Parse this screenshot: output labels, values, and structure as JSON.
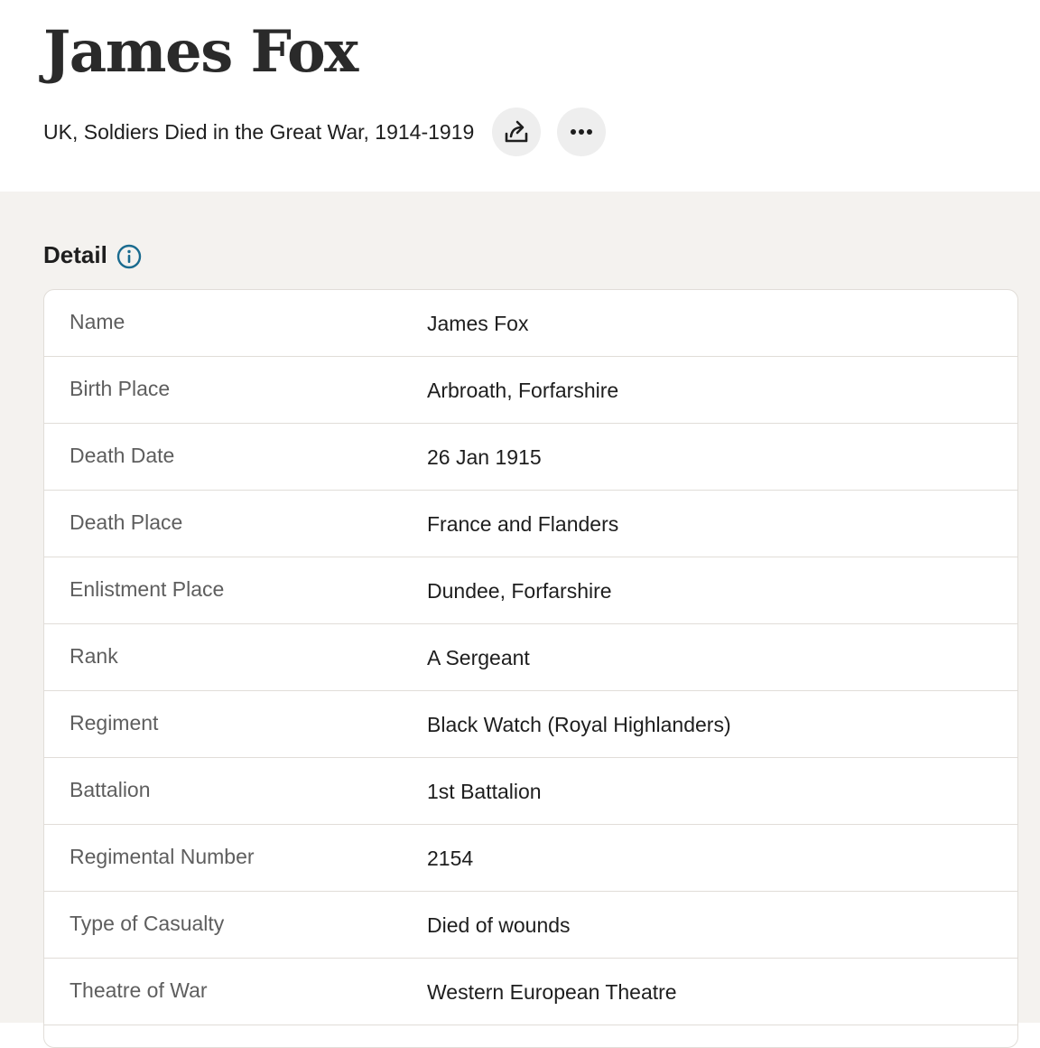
{
  "record": {
    "title": "James Fox",
    "collection": "UK, Soldiers Died in the Great War, 1914-1919",
    "actions": [
      {
        "icon": "share-icon"
      },
      {
        "icon": "more-options-icon"
      }
    ]
  },
  "detail": {
    "heading": "Detail",
    "info_icon": "info-icon",
    "rows": [
      {
        "label": "Name",
        "value": "James Fox"
      },
      {
        "label": "Birth Place",
        "value": "Arbroath, Forfarshire"
      },
      {
        "label": "Death Date",
        "value": "26 Jan 1915"
      },
      {
        "label": "Death Place",
        "value": "France and Flanders"
      },
      {
        "label": "Enlistment Place",
        "value": "Dundee, Forfarshire"
      },
      {
        "label": "Rank",
        "value": "A Sergeant"
      },
      {
        "label": "Regiment",
        "value": "Black Watch (Royal Highlanders)"
      },
      {
        "label": "Battalion",
        "value": "1st Battalion"
      },
      {
        "label": "Regimental Number",
        "value": "2154"
      },
      {
        "label": "Type of Casualty",
        "value": "Died of wounds"
      },
      {
        "label": "Theatre of War",
        "value": "Western European Theatre"
      }
    ]
  },
  "colors": {
    "content_background": "#f4f2ef",
    "icon_button_background": "#eeeeee",
    "info_icon_color": "#1a6b8f",
    "label_color": "#5e5e5e",
    "value_color": "#1e1e1e"
  }
}
